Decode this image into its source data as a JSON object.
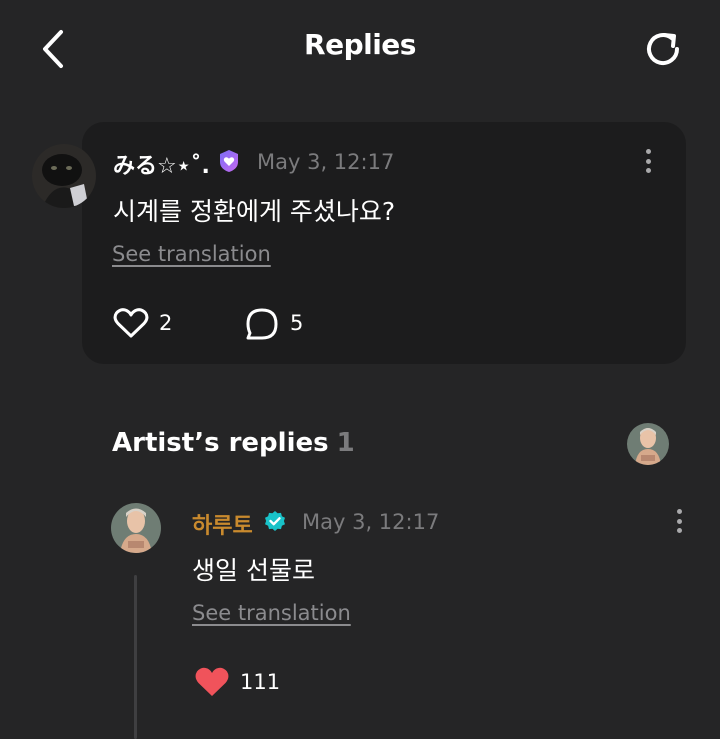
{
  "header": {
    "title": "Replies",
    "back_icon": "chevron-left-icon",
    "refresh_icon": "refresh-icon"
  },
  "comment": {
    "username": "みる☆⋆˚.",
    "badge_icon": "heart-badge-icon",
    "timestamp": "May 3, 12:17",
    "text": "시계를 정환에게 주셨나요?",
    "see_translation": "See translation",
    "like_count": "2",
    "reply_count": "5"
  },
  "artist_replies": {
    "title": "Artist’s replies",
    "count": "1"
  },
  "reply": {
    "username": "하루토",
    "verified_icon": "verified-badge-icon",
    "timestamp": "May 3, 12:17",
    "text": "생일 선물로",
    "see_translation": "See translation",
    "like_count": "111"
  },
  "colors": {
    "background": "#252526",
    "card": "#1c1c1d",
    "artist_name": "#c98a2e",
    "like_active": "#f0535b",
    "badge_purple": "#6c5ce7",
    "verified": "#19c2c8"
  }
}
